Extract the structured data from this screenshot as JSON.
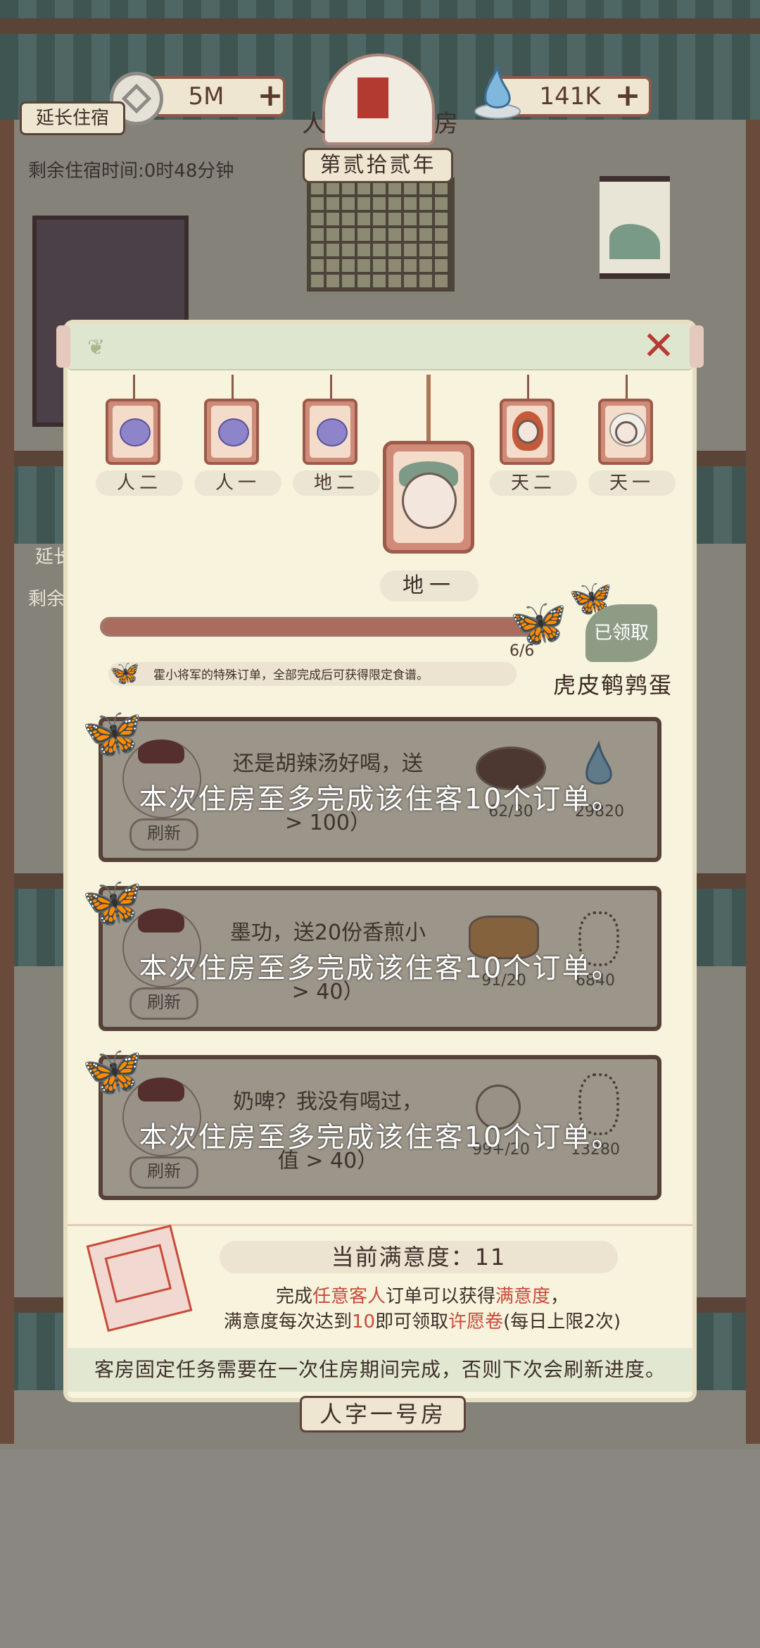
{
  "hud": {
    "coins": "5M",
    "spirit": "141K",
    "extend_stay": "延长住宿",
    "remaining_time": "剩余住宿时间:0时48分钟",
    "era": "第贰拾贰年",
    "room_sign_left": "人",
    "room_sign_right": "房",
    "extend_stay_2": "延长",
    "remaining_2": "剩余"
  },
  "modal": {
    "close_icon": "close-x-icon",
    "guests": [
      {
        "label": "人二",
        "portrait": "fruit"
      },
      {
        "label": "人一",
        "portrait": "fruit"
      },
      {
        "label": "地二",
        "portrait": "fruit"
      },
      {
        "label": "天二",
        "portrait": "red-hair-girl"
      },
      {
        "label": "天一",
        "portrait": "white-hair-boy"
      }
    ],
    "selected_guest": "地一",
    "progress": {
      "text": "6/6",
      "value": 6,
      "max": 6
    },
    "claimed": "已领取",
    "hint": "霍小将军的特殊订单，全部完成后可获得限定食谱。",
    "reward_recipe": "虎皮鹌鹑蛋",
    "orders": [
      {
        "desc_l1": "还是胡辣汤好喝，送",
        "desc_l2": "> 100）",
        "refresh": "刷新",
        "dish_count": "62/30",
        "reward": "29820",
        "overlay": "本次住房至多完成该住客10个订单。"
      },
      {
        "desc_l1": "墨功，送20份香煎小",
        "desc_l2": "> 40）",
        "refresh": "刷新",
        "dish_count": "91/20",
        "reward": "6840",
        "overlay": "本次住房至多完成该住客10个订单。"
      },
      {
        "desc_l1": "奶啤？我没有喝过，",
        "desc_l2": "值 > 40）",
        "refresh": "刷新",
        "dish_count": "99+/20",
        "reward": "13280",
        "overlay": "本次住房至多完成该住客10个订单。"
      }
    ],
    "satisfaction": {
      "title": "当前满意度：11",
      "l1_a": "完成",
      "l1_b": "任意客人",
      "l1_c": "订单可以获得",
      "l1_d": "满意度",
      "l1_e": "，",
      "l2_a": "满意度每次达到",
      "l2_b": "10",
      "l2_c": "即可领取",
      "l2_d": "许愿卷",
      "l2_e": "(每日上限2次)"
    },
    "notice": "客房固定任务需要在一次住房期间完成，否则下次会刷新进度。"
  },
  "room_name": "人字一号房",
  "colors": {
    "accent_red": "#c84a3a",
    "tag": "#d08a78",
    "panel": "#f8f3dc"
  }
}
